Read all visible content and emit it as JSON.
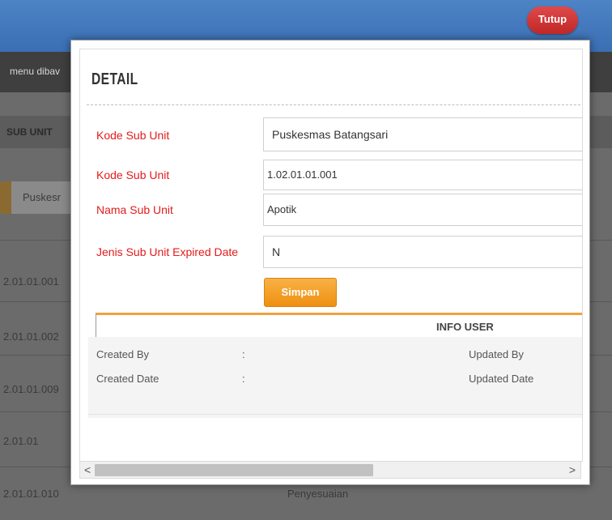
{
  "header": {
    "close_label": "Tutup"
  },
  "background": {
    "menu_hint": "menu dibav",
    "table_header": "SUB UNIT",
    "search_value": "Puskesr",
    "rows": [
      "2.01.01.001",
      "2.01.01.002",
      "2.01.01.009",
      "2.01.01",
      "2.01.01.010"
    ],
    "row5_col2": "Penyesuaian"
  },
  "modal": {
    "title": "DETAIL",
    "fields": [
      {
        "label": "Kode Sub Unit",
        "value": "Puskesmas Batangsari"
      },
      {
        "label": "Kode Sub Unit",
        "value": "1.02.01.01.001"
      },
      {
        "label": "Nama Sub Unit",
        "value": "Apotik"
      },
      {
        "label": "Jenis Sub Unit Expired Date",
        "value": "N"
      }
    ],
    "save_label": "Simpan",
    "info_user": {
      "title": "INFO USER",
      "created_by_label": "Created By",
      "created_date_label": "Created Date",
      "separator": ":",
      "updated_by_label": "Updated By",
      "updated_date_label": "Updated Date"
    }
  },
  "scrollbar": {
    "left_arrow": "<",
    "right_arrow": ">"
  }
}
